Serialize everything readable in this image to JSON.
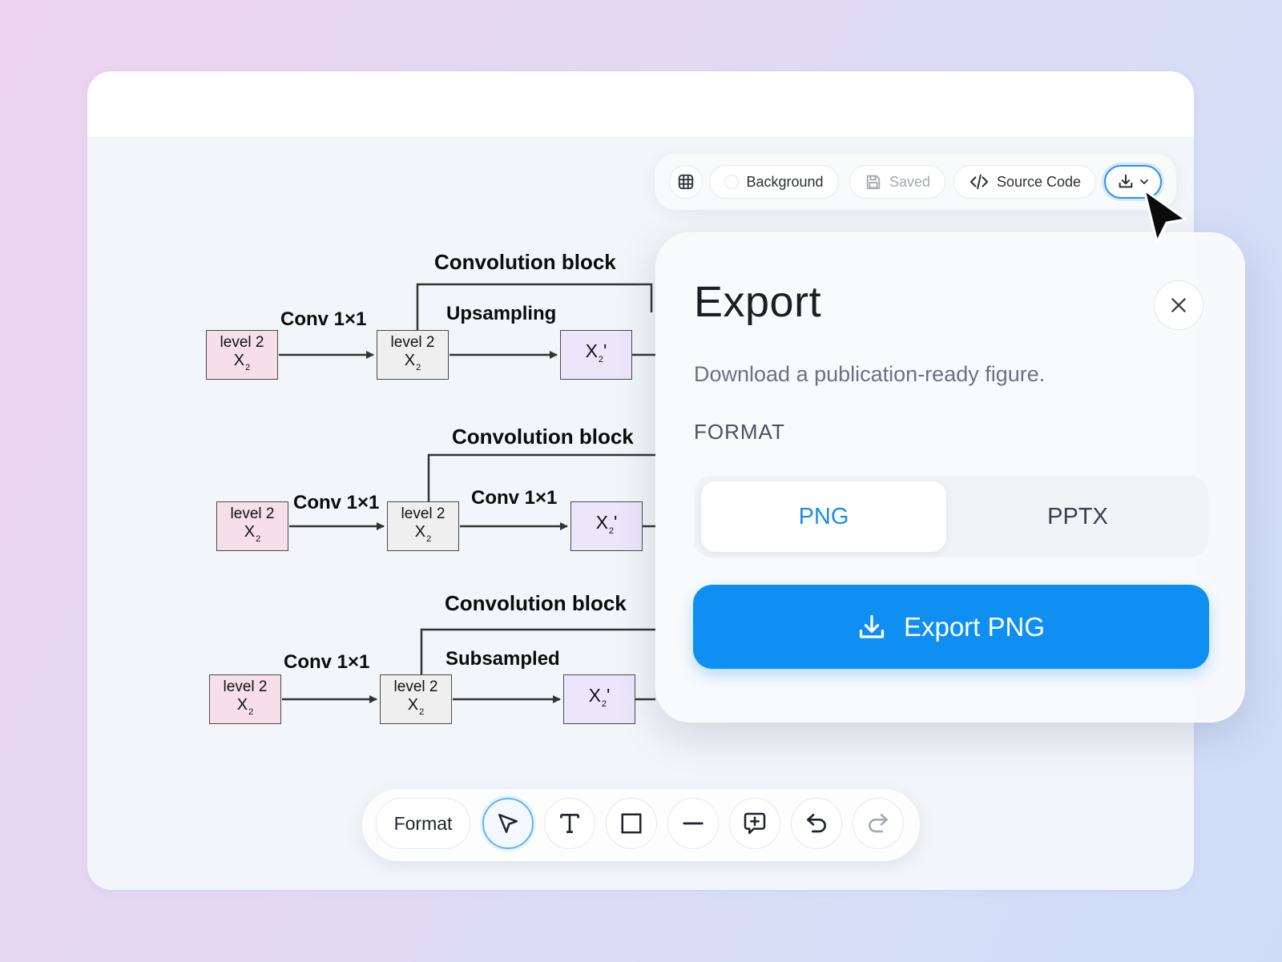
{
  "toolbar": {
    "background_label": "Background",
    "saved_label": "Saved",
    "source_code_label": "Source Code"
  },
  "diagram": {
    "rows": [
      {
        "block_label": "Convolution block",
        "first_op": "Conv 1×1",
        "second_op": "Upsampling",
        "input_box": {
          "line1": "level 2",
          "line2": "X",
          "sub": "2"
        },
        "mid_box": {
          "line1": "level 2",
          "line2": "X",
          "sub": "2"
        },
        "output_box": {
          "line2": "X",
          "sub": "2",
          "prime": "'"
        }
      },
      {
        "block_label": "Convolution block",
        "first_op": "Conv 1×1",
        "second_op": "Conv 1×1",
        "input_box": {
          "line1": "level 2",
          "line2": "X",
          "sub": "2"
        },
        "mid_box": {
          "line1": "level 2",
          "line2": "X",
          "sub": "2"
        },
        "output_box": {
          "line2": "X",
          "sub": "2",
          "prime": "'"
        }
      },
      {
        "block_label": "Convolution block",
        "first_op": "Conv 1×1",
        "second_op": "Subsampled",
        "input_box": {
          "line1": "level 2",
          "line2": "X",
          "sub": "2"
        },
        "mid_box": {
          "line1": "level 2",
          "line2": "X",
          "sub": "2"
        },
        "output_box": {
          "line2": "X",
          "sub": "2",
          "prime": "'"
        }
      }
    ],
    "colors": {
      "input": "#f6dfe8",
      "middle": "#efefef",
      "output": "#ece6fb"
    }
  },
  "export_panel": {
    "title": "Export",
    "description": "Download a publication-ready figure.",
    "format_label": "FORMAT",
    "formats": [
      "PNG",
      "PPTX"
    ],
    "selected_format": "PNG",
    "export_button_label": "Export PNG"
  },
  "bottom_toolbar": {
    "format_label": "Format",
    "tools": [
      "select-icon",
      "text-icon",
      "rectangle-icon",
      "line-icon",
      "add-comment-icon",
      "undo-icon",
      "redo-icon"
    ],
    "active_tool": "select-icon"
  },
  "colors": {
    "accent": "#0f8ff2",
    "selected_text": "#1a8ee8"
  }
}
